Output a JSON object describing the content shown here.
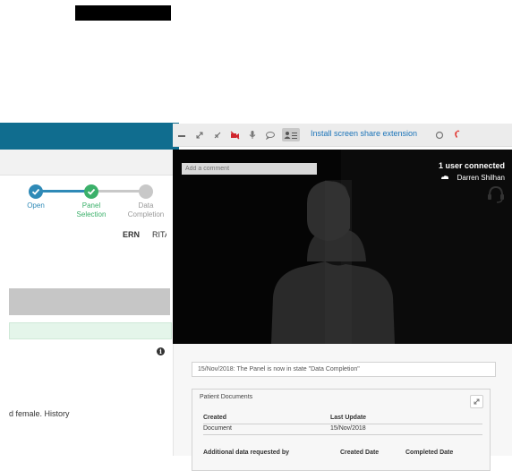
{
  "stepper": {
    "steps": [
      {
        "label": "Open"
      },
      {
        "label": "Panel\nSelection"
      },
      {
        "label": "Data\nCompletion"
      }
    ]
  },
  "case": {
    "ern": "ERN",
    "rita": "RITA",
    "history": "d female. History"
  },
  "call": {
    "toolbar": {
      "share_label": "Install screen share extension"
    },
    "comment_placeholder": "Add a comment",
    "users_connected": "1 user connected",
    "user_name": "Darren Shilhan"
  },
  "panel": {
    "state_message": "15/Nov/2018: The Panel is now in state \"Data Completion\"",
    "documents": {
      "title": "Patient Documents",
      "columns": [
        "Created",
        "Last Update"
      ],
      "rows": [
        [
          "Document",
          "15/Nov/2018"
        ]
      ],
      "extra_columns": [
        "Additional data requested by",
        "Created Date",
        "Completed Date"
      ]
    }
  },
  "colors": {
    "header": "#106d8f",
    "step_done": "#2f8ab7",
    "step_active": "#3bb06a",
    "step_pending": "#c8c8c8",
    "link": "#1a73b8",
    "hangup": "#e0302a"
  }
}
